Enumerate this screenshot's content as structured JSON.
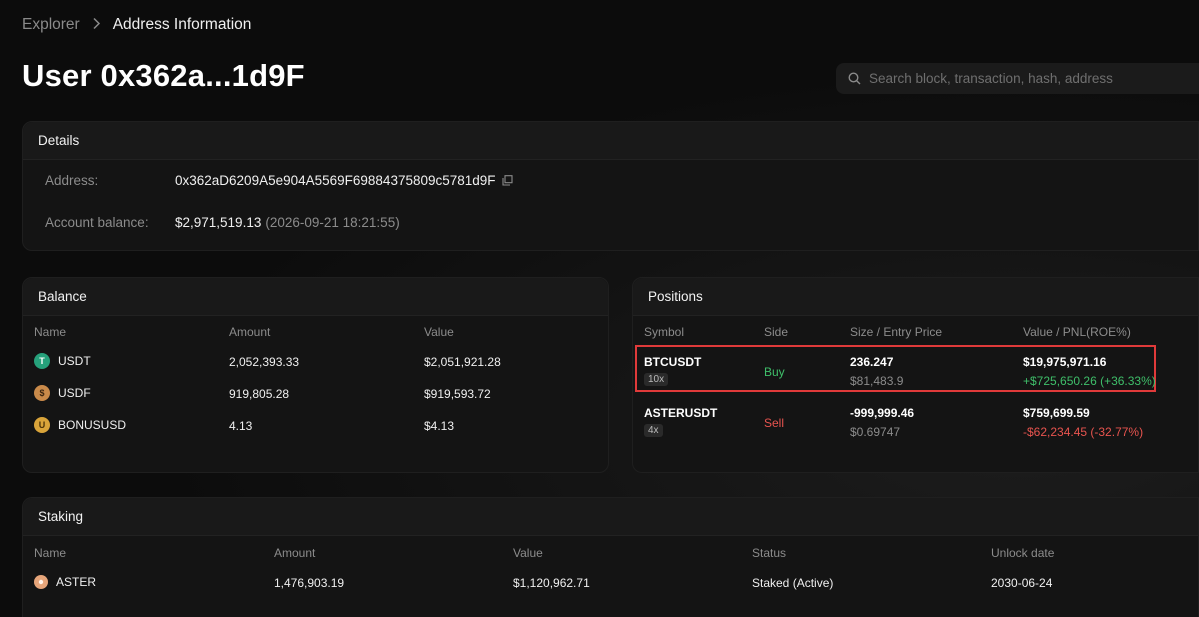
{
  "breadcrumb": {
    "root": "Explorer",
    "current": "Address Information"
  },
  "page_title": "User 0x362a...1d9F",
  "search": {
    "placeholder": "Search block, transaction, hash, address"
  },
  "details": {
    "title": "Details",
    "address_label": "Address:",
    "address_value": "0x362aD6209A5e904A5569F69884375809c5781d9F",
    "balance_label": "Account balance:",
    "balance_value": "$2,971,519.13",
    "balance_time": "(2026-09-21 18:21:55)"
  },
  "balance": {
    "title": "Balance",
    "columns": [
      "Name",
      "Amount",
      "Value"
    ],
    "rows": [
      {
        "name": "USDT",
        "amount": "2,052,393.33",
        "value": "$2,051,921.28",
        "icon": "usdt-icon",
        "color": "#26a17b"
      },
      {
        "name": "USDF",
        "amount": "919,805.28",
        "value": "$919,593.72",
        "icon": "usdf-icon",
        "color": "#c98a4a"
      },
      {
        "name": "BONUSUSD",
        "amount": "4.13",
        "value": "$4.13",
        "icon": "bonususd-icon",
        "color": "#d9a43a"
      }
    ]
  },
  "positions": {
    "title": "Positions",
    "columns": [
      "Symbol",
      "Side",
      "Size / Entry Price",
      "Value / PNL(ROE%)"
    ],
    "rows": [
      {
        "symbol": "BTCUSDT",
        "leverage": "10x",
        "side": "Buy",
        "size": "236.247",
        "entry": "$81,483.9",
        "value": "$19,975,971.16",
        "pnl": "+$725,650.26 (+36.33%)"
      },
      {
        "symbol": "ASTERUSDT",
        "leverage": "4x",
        "side": "Sell",
        "size": "-999,999.46",
        "entry": "$0.69747",
        "value": "$759,699.59",
        "pnl": "-$62,234.45 (-32.77%)"
      }
    ]
  },
  "staking": {
    "title": "Staking",
    "columns": [
      "Name",
      "Amount",
      "Value",
      "Status",
      "Unlock date"
    ],
    "rows": [
      {
        "name": "ASTER",
        "amount": "1,476,903.19",
        "value": "$1,120,962.71",
        "status": "Staked (Active)",
        "unlock": "2030-06-24",
        "icon": "aster-icon"
      }
    ]
  },
  "colors": {
    "buy": "#3fbf6a",
    "sell": "#e8544f",
    "highlight": "#e03a3a"
  }
}
